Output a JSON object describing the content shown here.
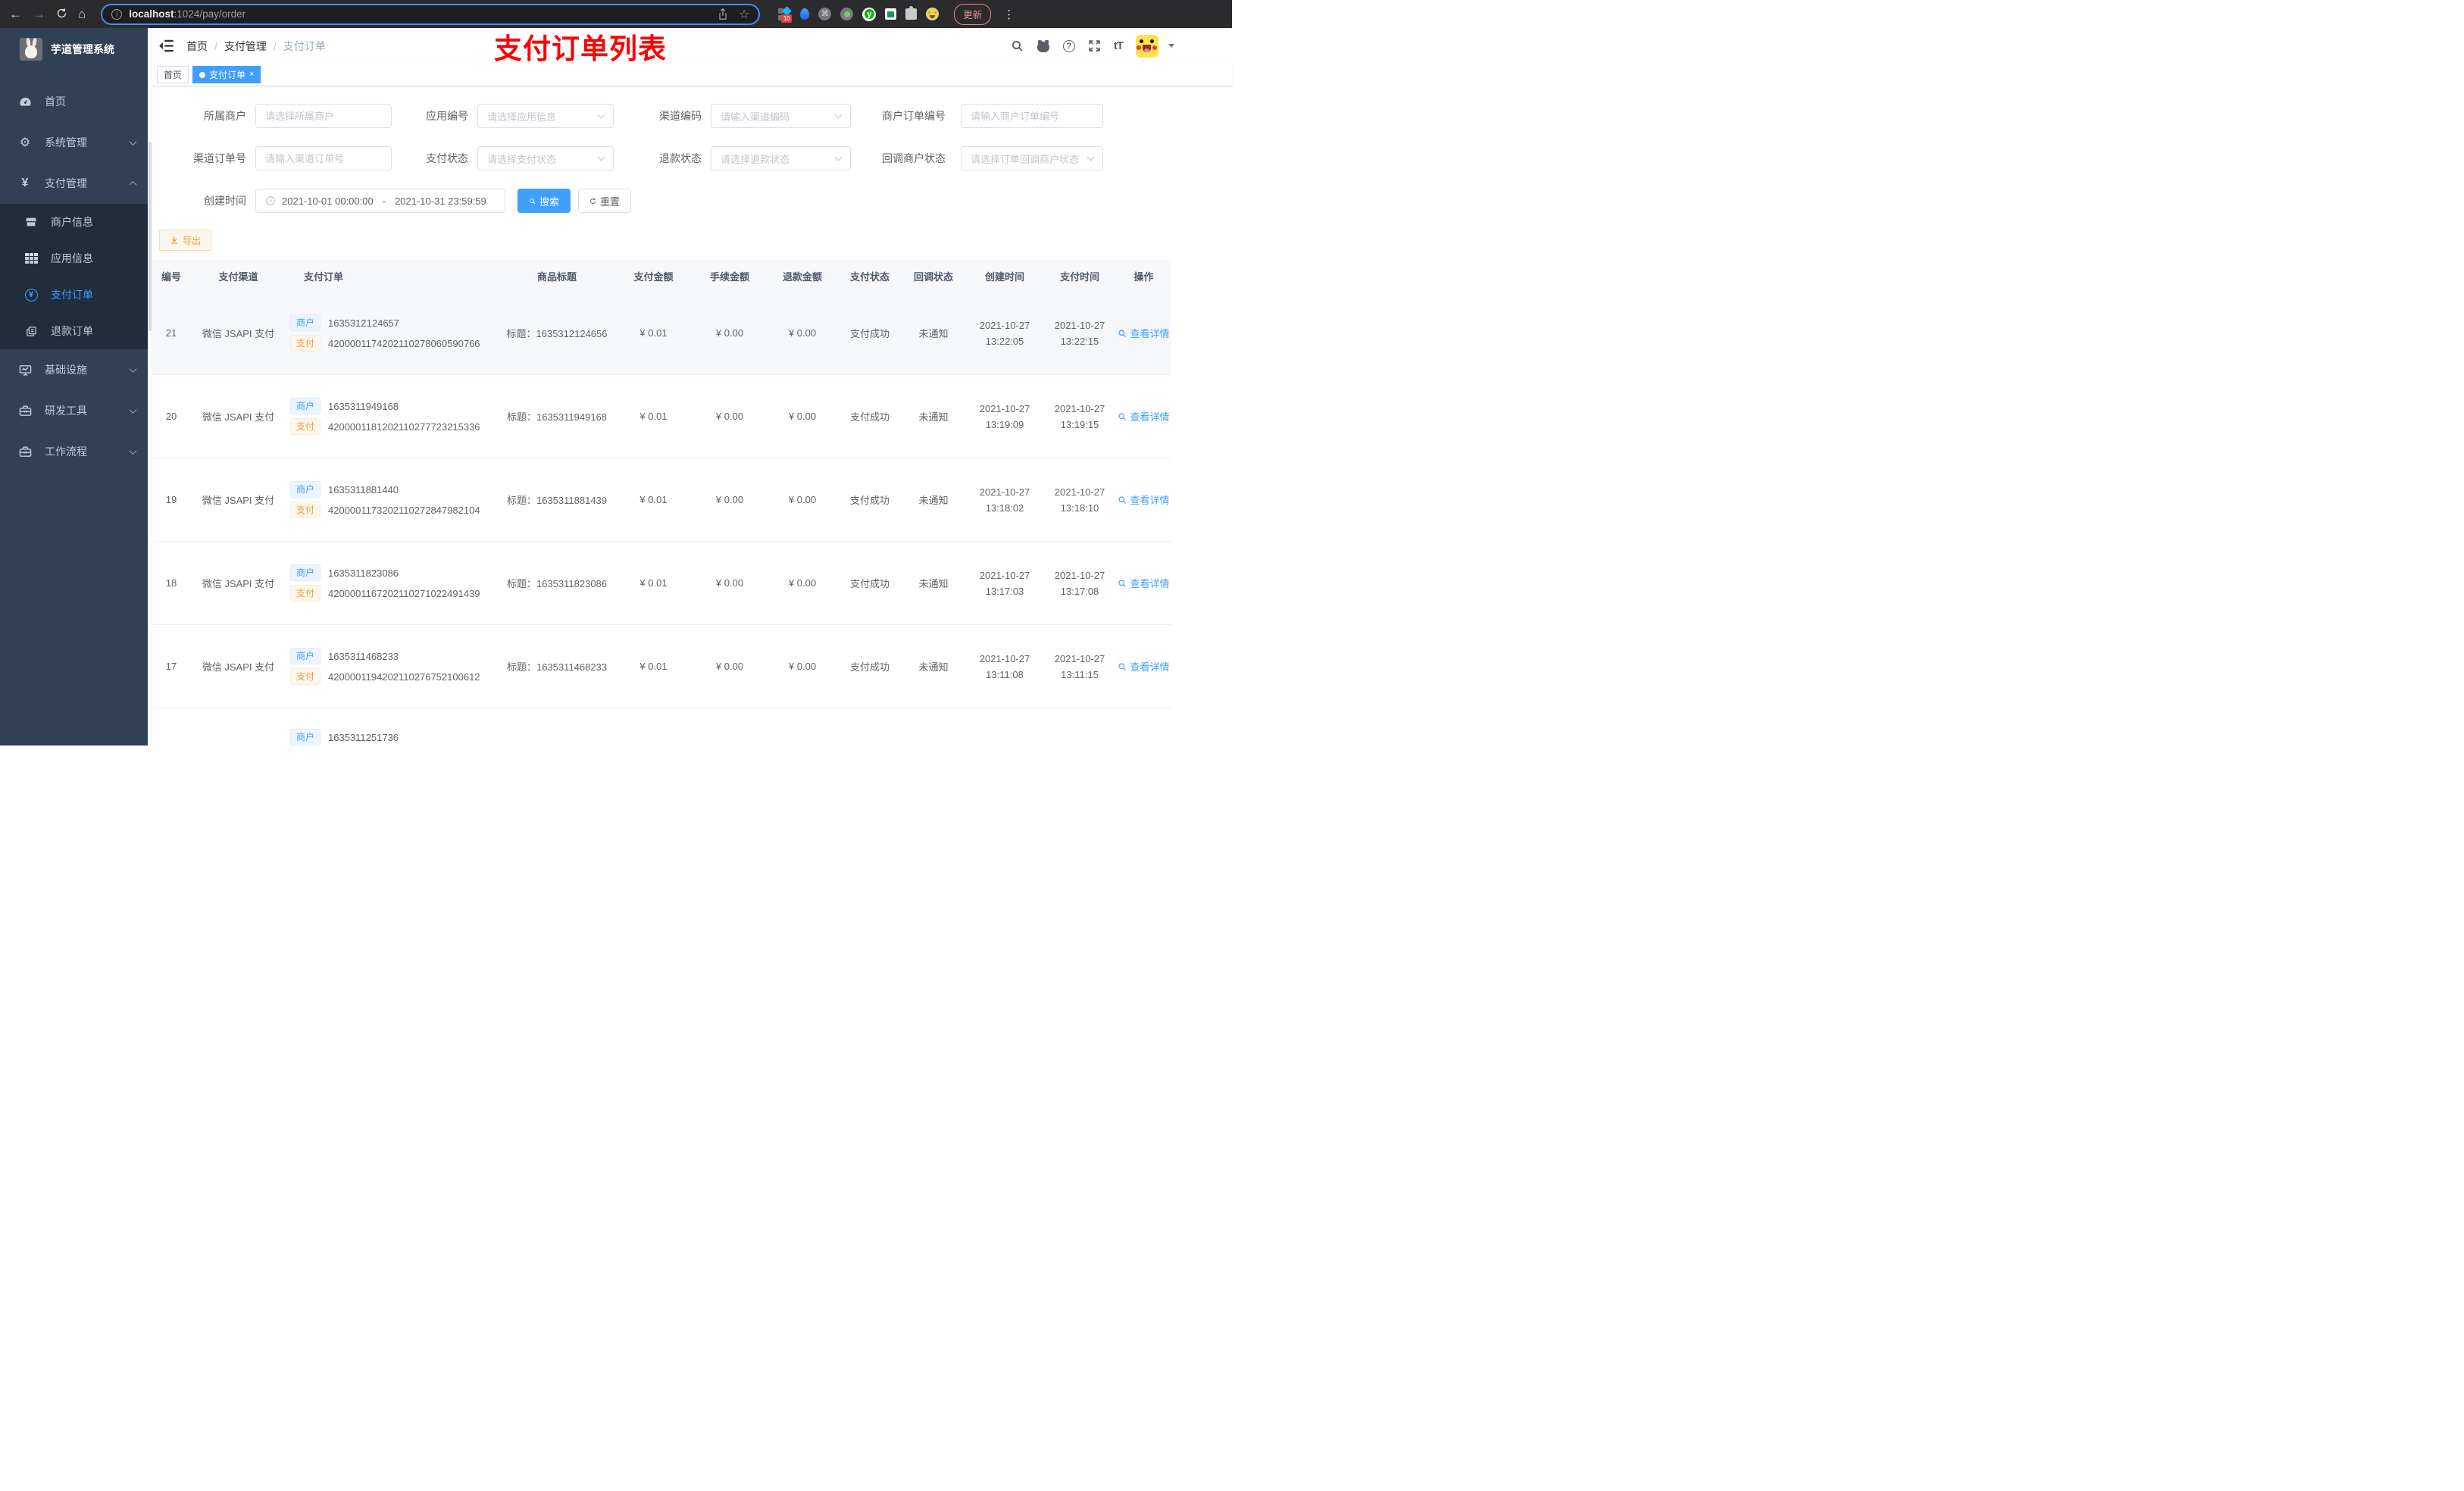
{
  "browser": {
    "url": {
      "host": "localhost",
      "rest": ":1024/pay/order"
    },
    "extensions_badge": "10",
    "update_label": "更新"
  },
  "icons": {
    "back": "←",
    "forward": "→",
    "home": "⌂",
    "star": "☆",
    "info": "i",
    "dots": "⋮",
    "command": "⌘",
    "gear": "⚙",
    "yen": "¥",
    "question": "?",
    "font_size": "tT",
    "close": "×"
  },
  "sidebar": {
    "title": "芋道管理系统",
    "menu": [
      {
        "label": "首页"
      },
      {
        "label": "系统管理"
      },
      {
        "label": "支付管理"
      },
      {
        "label": "基础设施"
      },
      {
        "label": "研发工具"
      },
      {
        "label": "工作流程"
      }
    ],
    "submenu": [
      {
        "label": "商户信息"
      },
      {
        "label": "应用信息"
      },
      {
        "label": "支付订单"
      },
      {
        "label": "退款订单"
      }
    ]
  },
  "navbar": {
    "breadcrumb": [
      "首页",
      "支付管理",
      "支付订单"
    ],
    "separator": "/",
    "annotation": "支付订单列表"
  },
  "tabs": [
    {
      "label": "首页",
      "active": false
    },
    {
      "label": "支付订单",
      "active": true
    }
  ],
  "filters": {
    "fields": [
      {
        "label": "所属商户",
        "placeholder": "请选择所属商户"
      },
      {
        "label": "应用编号",
        "placeholder": "请选择应用信息"
      },
      {
        "label": "渠道编码",
        "placeholder": "请输入渠道编码"
      },
      {
        "label": "商户订单编号",
        "placeholder": "请输入商户订单编号"
      },
      {
        "label": "渠道订单号",
        "placeholder": "请输入渠道订单号"
      },
      {
        "label": "支付状态",
        "placeholder": "请选择支付状态"
      },
      {
        "label": "退款状态",
        "placeholder": "请选择退款状态"
      },
      {
        "label": "回调商户状态",
        "placeholder": "请选择订单回调商户状态"
      }
    ],
    "date": {
      "label": "创建时间",
      "start": "2021-10-01 00:00:00",
      "separator": "-",
      "end": "2021-10-31 23:59:59"
    },
    "search_label": "搜索",
    "reset_label": "重置"
  },
  "toolbar": {
    "export_label": "导出"
  },
  "table": {
    "columns": [
      "编号",
      "支付渠道",
      "支付订单",
      "商品标题",
      "支付金额",
      "手续金额",
      "退款金额",
      "支付状态",
      "回调状态",
      "创建时间",
      "支付时间",
      "操作"
    ],
    "rows": [
      {
        "id": "21",
        "channel": "微信 JSAPI 支付",
        "merchant_tag": "商户",
        "merchant_no": "1635312124657",
        "pay_tag": "支付",
        "pay_no": "4200001174202110278060590766",
        "title": "标题：1635312124656",
        "amount": "¥ 0.01",
        "fee": "¥ 0.00",
        "refund": "¥ 0.00",
        "status": "支付成功",
        "notify": "未通知",
        "created_date": "2021-10-27",
        "created_time": "13:22:05",
        "paid_date": "2021-10-27",
        "paid_time": "13:22:15",
        "action": "查看详情"
      },
      {
        "id": "20",
        "channel": "微信 JSAPI 支付",
        "merchant_tag": "商户",
        "merchant_no": "1635311949168",
        "pay_tag": "支付",
        "pay_no": "4200001181202110277723215336",
        "title": "标题：1635311949168",
        "amount": "¥ 0.01",
        "fee": "¥ 0.00",
        "refund": "¥ 0.00",
        "status": "支付成功",
        "notify": "未通知",
        "created_date": "2021-10-27",
        "created_time": "13:19:09",
        "paid_date": "2021-10-27",
        "paid_time": "13:19:15",
        "action": "查看详情"
      },
      {
        "id": "19",
        "channel": "微信 JSAPI 支付",
        "merchant_tag": "商户",
        "merchant_no": "1635311881440",
        "pay_tag": "支付",
        "pay_no": "4200001173202110272847982104",
        "title": "标题：1635311881439",
        "amount": "¥ 0.01",
        "fee": "¥ 0.00",
        "refund": "¥ 0.00",
        "status": "支付成功",
        "notify": "未通知",
        "created_date": "2021-10-27",
        "created_time": "13:18:02",
        "paid_date": "2021-10-27",
        "paid_time": "13:18:10",
        "action": "查看详情"
      },
      {
        "id": "18",
        "channel": "微信 JSAPI 支付",
        "merchant_tag": "商户",
        "merchant_no": "1635311823086",
        "pay_tag": "支付",
        "pay_no": "4200001167202110271022491439",
        "title": "标题：1635311823086",
        "amount": "¥ 0.01",
        "fee": "¥ 0.00",
        "refund": "¥ 0.00",
        "status": "支付成功",
        "notify": "未通知",
        "created_date": "2021-10-27",
        "created_time": "13:17:03",
        "paid_date": "2021-10-27",
        "paid_time": "13:17:08",
        "action": "查看详情"
      },
      {
        "id": "17",
        "channel": "微信 JSAPI 支付",
        "merchant_tag": "商户",
        "merchant_no": "1635311468233",
        "pay_tag": "支付",
        "pay_no": "4200001194202110276752100612",
        "title": "标题：1635311468233",
        "amount": "¥ 0.01",
        "fee": "¥ 0.00",
        "refund": "¥ 0.00",
        "status": "支付成功",
        "notify": "未通知",
        "created_date": "2021-10-27",
        "created_time": "13:11:08",
        "paid_date": "2021-10-27",
        "paid_time": "13:11:15",
        "action": "查看详情"
      }
    ],
    "partial_row": {
      "merchant_tag": "商户",
      "merchant_no": "1635311251736"
    }
  },
  "colors": {
    "primary": "#409eff",
    "warning": "#e6a23c",
    "annotation": "#ff0000",
    "sidebar_bg": "#304156",
    "submenu_bg": "#1f2d3d"
  }
}
